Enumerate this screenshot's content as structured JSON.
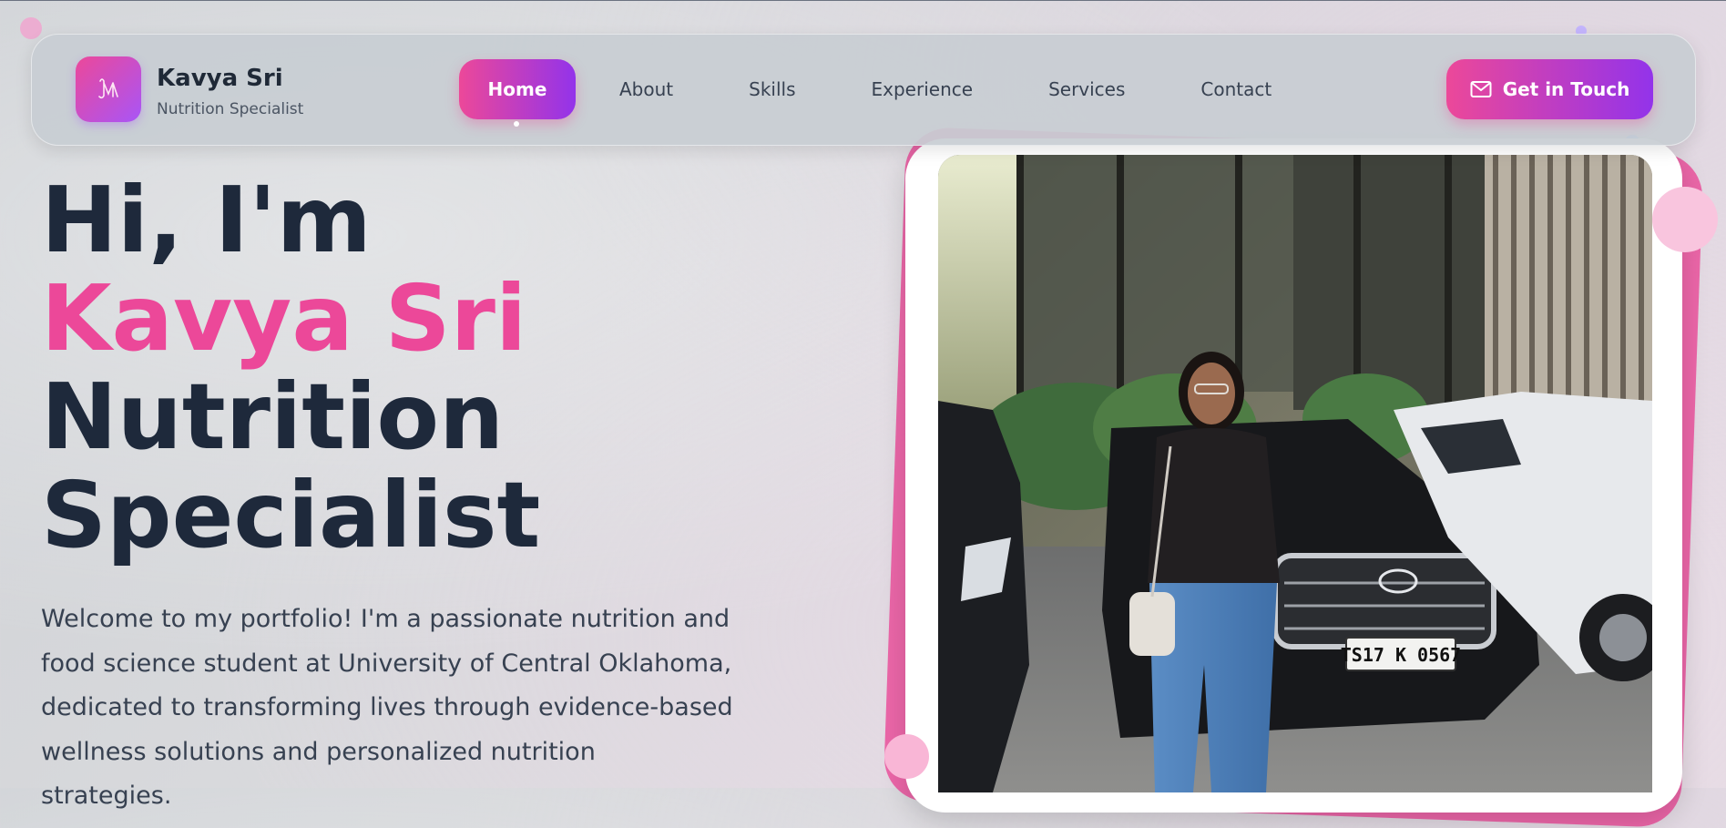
{
  "brand": {
    "name": "Kavya Sri",
    "subtitle": "Nutrition Specialist",
    "logo_icon": "monogram-icon"
  },
  "nav": {
    "items": [
      {
        "label": "Home",
        "active": true
      },
      {
        "label": "About",
        "active": false
      },
      {
        "label": "Skills",
        "active": false
      },
      {
        "label": "Experience",
        "active": false
      },
      {
        "label": "Services",
        "active": false
      },
      {
        "label": "Contact",
        "active": false
      }
    ],
    "cta_label": "Get in Touch",
    "cta_icon": "mail-icon"
  },
  "hero": {
    "line1": "Hi, I'm",
    "name": "Kavya Sri",
    "line3": "Nutrition",
    "line4": "Specialist",
    "description": "Welcome to my portfolio! I'm a passionate nutrition and food science student at University of Central Oklahoma, dedicated to transforming lives through evidence-based wellness solutions and personalized nutrition strategies."
  },
  "photo": {
    "plate_text": "TS17 K 0567"
  },
  "colors": {
    "accent_pink": "#ec4899",
    "accent_purple": "#9333ea",
    "heading": "#1e293b"
  }
}
